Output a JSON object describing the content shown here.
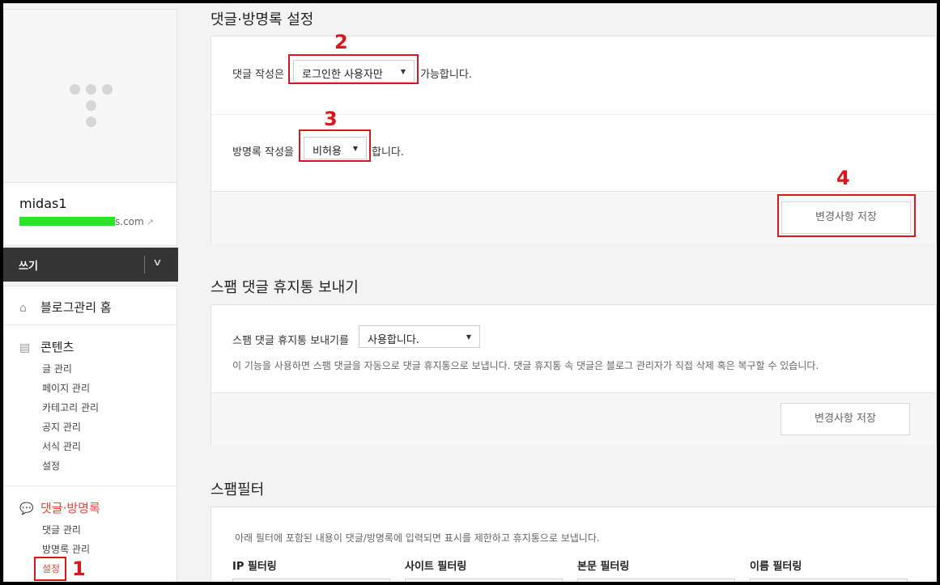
{
  "sidebar": {
    "blog_name": "midas1",
    "blog_url_suffix": "s.com",
    "write_label": "쓰기",
    "home_label": "블로그관리 홈",
    "contents": {
      "label": "콘텐츠",
      "items": [
        "글 관리",
        "페이지 관리",
        "카테고리 관리",
        "공지 관리",
        "서식 관리",
        "설정"
      ]
    },
    "comments": {
      "label": "댓글·방명록",
      "items": [
        "댓글 관리",
        "방명록 관리",
        "설정"
      ]
    }
  },
  "comment_settings": {
    "title": "댓글·방명록 설정",
    "comment_prefix": "댓글 작성은",
    "comment_select": "로그인한 사용자만",
    "comment_suffix": "가능합니다.",
    "guestbook_prefix": "방명록 작성을",
    "guestbook_select": "비허용",
    "guestbook_suffix": "합니다.",
    "save_label": "변경사항 저장"
  },
  "spam_trash": {
    "title": "스팸 댓글 휴지통 보내기",
    "prefix": "스팸 댓글 휴지통 보내기를",
    "select": "사용합니다.",
    "note": "이 기능을 사용하면 스팸 댓글을 자동으로 댓글 휴지통으로 보냅니다. 댓글 휴지통 속 댓글은 블로그 관리자가 직접 삭제 혹은 복구할 수 있습니다.",
    "save_label": "변경사항 저장"
  },
  "spam_filter": {
    "title": "스팸필터",
    "note": "아래 필터에 포함된 내용이 댓글/방명록에 입력되면 표시를 제한하고 휴지통으로 보냅니다.",
    "filters": [
      "IP 필터링",
      "사이트 필터링",
      "본문 필터링",
      "이름 필터링"
    ]
  },
  "annotations": [
    "1",
    "2",
    "3",
    "4"
  ],
  "colors": {
    "accent": "#e6483f",
    "annotation": "#d8181e",
    "url_mask": "#28e42a"
  }
}
